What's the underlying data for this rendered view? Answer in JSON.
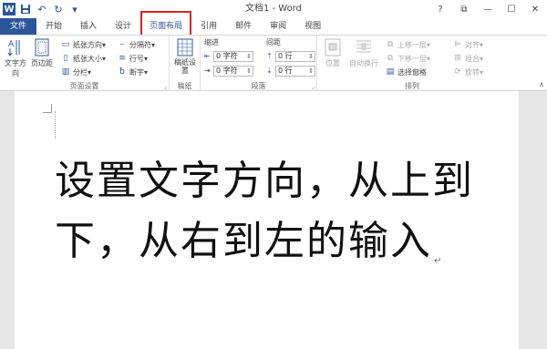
{
  "window": {
    "title": "文档1 - Word",
    "qat": {
      "logo": "W",
      "save_icon": "save-icon",
      "undo": "↶",
      "redo": "↻",
      "customize": "▾"
    },
    "controls": {
      "help": "?",
      "ribbon_options": "⧉",
      "minimize": "—",
      "maximize": "☐",
      "close": "✕"
    }
  },
  "tabs": [
    {
      "label": "文件"
    },
    {
      "label": "开始"
    },
    {
      "label": "插入"
    },
    {
      "label": "设计"
    },
    {
      "label": "页面布局",
      "active": true
    },
    {
      "label": "引用"
    },
    {
      "label": "邮件"
    },
    {
      "label": "审阅"
    },
    {
      "label": "视图"
    }
  ],
  "ribbon": {
    "page_setup": {
      "label": "页面设置",
      "text_direction": "文字方向",
      "margins": "页边距",
      "orientation": "纸张方向",
      "size": "纸张大小",
      "columns": "分栏",
      "breaks": "分隔符",
      "line_numbers": "行号",
      "hyphenation": "断字"
    },
    "draft": {
      "label": "稿纸",
      "draft_settings": "稿纸设置"
    },
    "paragraph": {
      "label": "段落",
      "indent_label": "缩进",
      "spacing_label": "间距",
      "indent_left": "0 字符",
      "indent_right": "0 字符",
      "spacing_before": "0 行",
      "spacing_after": "0 行"
    },
    "arrange": {
      "label": "排列",
      "position": "位置",
      "wrap_text": "自动换行",
      "bring_forward": "上移一层",
      "send_backward": "下移一层",
      "selection_pane": "选择窗格",
      "align": "对齐",
      "group": "组合",
      "rotate": "旋转"
    }
  },
  "document": {
    "lines": [
      "设置文字方向，从上到",
      "下，从右到左的输入"
    ],
    "paragraph_mark": "↵"
  }
}
